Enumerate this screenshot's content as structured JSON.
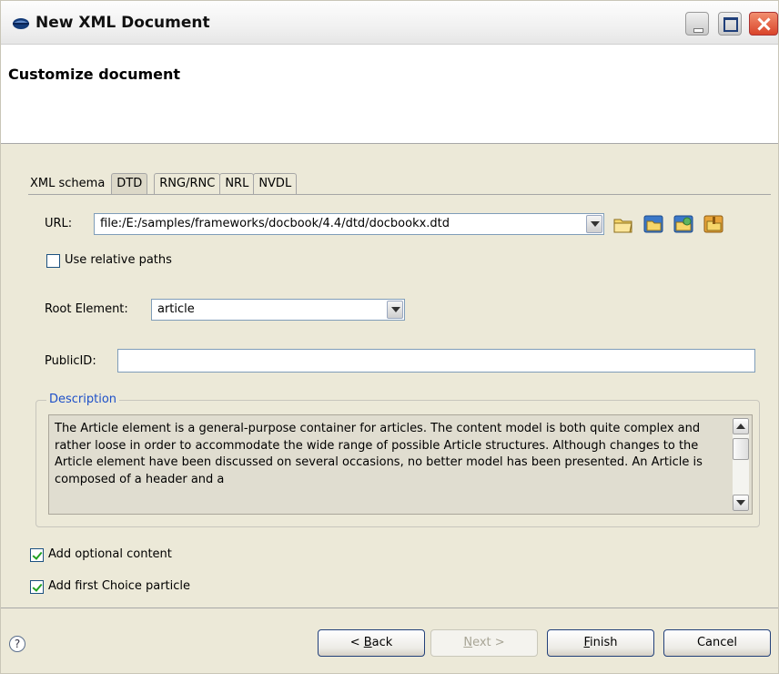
{
  "window": {
    "title": "New XML Document"
  },
  "header": {
    "title": "Customize document"
  },
  "tabs": [
    {
      "label": "XML schema",
      "active": false
    },
    {
      "label": "DTD",
      "active": true
    },
    {
      "label": "RNG/RNC",
      "active": false
    },
    {
      "label": "NRL",
      "active": false
    },
    {
      "label": "NVDL",
      "active": false
    }
  ],
  "url": {
    "label": "URL:",
    "value": "file:/E:/samples/frameworks/docbook/4.4/dtd/docbookx.dtd",
    "toolbar_icons": [
      "browse-local-file-icon",
      "browse-workspace-icon",
      "browse-url-icon",
      "browse-archive-icon"
    ]
  },
  "relative_paths": {
    "label": "Use relative paths",
    "checked": false
  },
  "root_element": {
    "label": "Root Element:",
    "value": "article"
  },
  "public_id": {
    "label": "PublicID:",
    "value": ""
  },
  "description": {
    "label": "Description",
    "text": "The Article element is a general-purpose container for articles. The content model is both quite complex and rather loose in order to accommodate the wide range of possible Article structures. Although changes to the Article element have been discussed on several occasions, no better model has been presented. An Article is composed of a header and a"
  },
  "options": {
    "optional_content": {
      "label": "Add optional content",
      "checked": true
    },
    "first_choice": {
      "label": "Add first Choice particle",
      "checked": true
    }
  },
  "buttons": {
    "help": "?",
    "back": {
      "prefix": "< ",
      "mnemonic": "B",
      "rest": "ack"
    },
    "next": {
      "mnemonic": "N",
      "rest": "ext >",
      "enabled": false
    },
    "finish": {
      "mnemonic": "F",
      "rest": "inish"
    },
    "cancel": "Cancel"
  },
  "colors": {
    "accent": "#1e50c8",
    "button_border": "#22407a",
    "close": "#d9442a"
  }
}
